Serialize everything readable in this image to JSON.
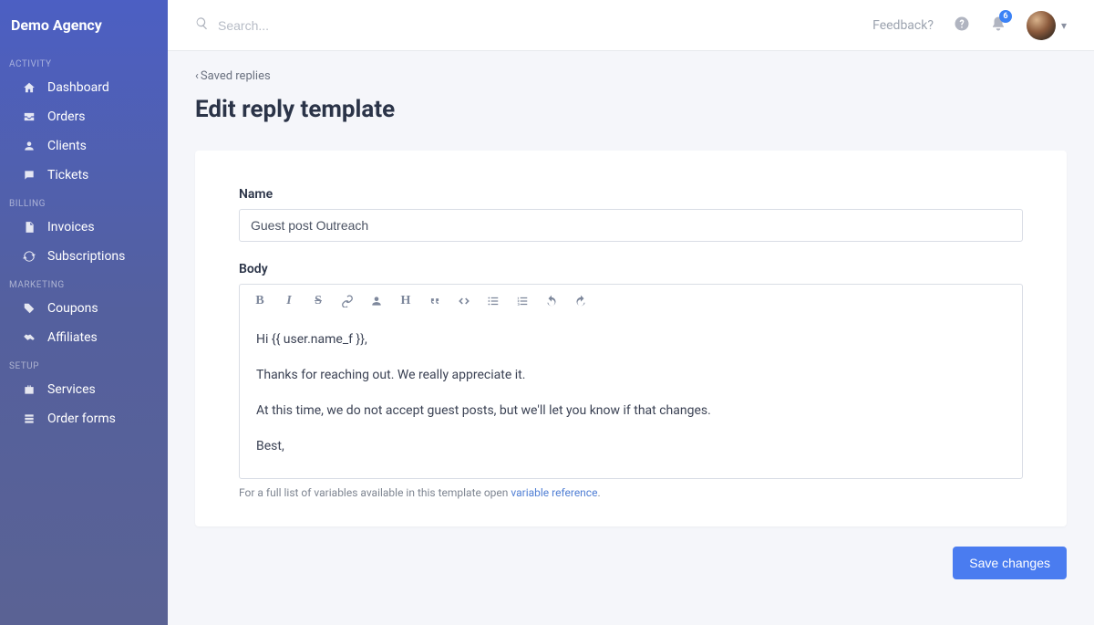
{
  "brand": "Demo Agency",
  "sidebar": {
    "sections": [
      {
        "header": "ACTIVITY",
        "items": [
          {
            "label": "Dashboard",
            "icon": "home-icon"
          },
          {
            "label": "Orders",
            "icon": "inbox-icon"
          },
          {
            "label": "Clients",
            "icon": "user-icon"
          },
          {
            "label": "Tickets",
            "icon": "chat-icon"
          }
        ]
      },
      {
        "header": "BILLING",
        "items": [
          {
            "label": "Invoices",
            "icon": "file-icon"
          },
          {
            "label": "Subscriptions",
            "icon": "refresh-icon"
          }
        ]
      },
      {
        "header": "MARKETING",
        "items": [
          {
            "label": "Coupons",
            "icon": "tag-icon"
          },
          {
            "label": "Affiliates",
            "icon": "handshake-icon"
          }
        ]
      },
      {
        "header": "SETUP",
        "items": [
          {
            "label": "Services",
            "icon": "briefcase-icon"
          },
          {
            "label": "Order forms",
            "icon": "form-icon"
          }
        ]
      }
    ]
  },
  "topbar": {
    "search_placeholder": "Search...",
    "feedback_label": "Feedback?",
    "notification_count": "6"
  },
  "page": {
    "back_link_label": "Saved replies",
    "title": "Edit reply template"
  },
  "form": {
    "name_label": "Name",
    "name_value": "Guest post Outreach",
    "body_label": "Body",
    "body_paragraphs": [
      "Hi {{ user.name_f }},",
      "Thanks for reaching out. We really appreciate it.",
      "At this time, we do not accept guest posts, but we'll let you know if that changes.",
      "Best,"
    ],
    "help_text_prefix": "For a full list of variables available in this template open ",
    "help_link_text": "variable reference",
    "help_text_suffix": "."
  },
  "actions": {
    "save_label": "Save changes"
  }
}
